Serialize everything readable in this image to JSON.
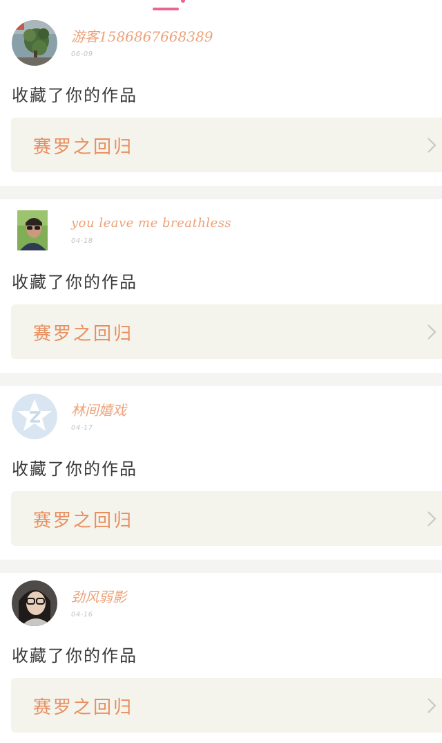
{
  "colors": {
    "accent": "#e8668f",
    "username": "#eda27a",
    "work_title": "#e88e5e",
    "work_bg": "#f4f3ec",
    "divider": "#f4f4f2"
  },
  "feed": {
    "items": [
      {
        "username": "游客15868676683​89",
        "date": "06-09",
        "action": "收藏了你的作品",
        "work_title": "赛罗之回归",
        "avatar": "plant-photo-avatar"
      },
      {
        "username": "you leave me breathless",
        "date": "04-18",
        "action": "收藏了你的作品",
        "work_title": "赛罗之回归",
        "avatar": "person-sunglasses-avatar"
      },
      {
        "username": "林间嬉戏",
        "date": "04-17",
        "action": "收藏了你的作品",
        "work_title": "赛罗之回归",
        "avatar": "default-qzone-avatar"
      },
      {
        "username": "劲风弱影",
        "date": "04-16",
        "action": "收藏了你的作品",
        "work_title": "赛罗之回归",
        "avatar": "person-glasses-avatar"
      }
    ]
  }
}
